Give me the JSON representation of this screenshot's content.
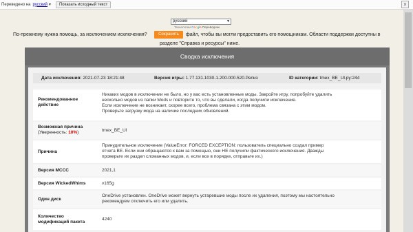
{
  "translate_bar": {
    "translated_to_label": "Переведено на",
    "language": "русский",
    "show_original_button": "Показать исходный текст",
    "close_glyph": "×"
  },
  "language_select": {
    "value": "русский",
    "powered_by": "Технологии",
    "google_letters": [
      "G",
      "o",
      "o",
      "g",
      "l",
      "e"
    ],
    "translator": "Переводчик"
  },
  "intro": {
    "line1_prefix": "По-прежнему нужна помощь, за исключением исключения?",
    "save_button": "Сохранить",
    "line1_suffix": "файл, чтобы вы могли предоставить его помощникам. Области поддержки доступны в",
    "line2": "разделе \"Справка и ресурсы\" ниже."
  },
  "panel": {
    "title": "Сводка исключения",
    "summary": {
      "date_label": "Дата исключения:",
      "date_value": "2021-07-23 18:21:48",
      "version_label": "Версия игры:",
      "version_value": "1.77.131.1030-1.200.000.520.Релиз",
      "category_label": "ID категории:",
      "category_value": "tmex_BE_UI.py:244"
    },
    "rows": {
      "recommended": {
        "label_line1": "Рекомендованное",
        "label_line2": "действие",
        "line1": "Никаких модов в исключении не было, но у вас есть установленные моды. Закройте игру, попробуйте удалить",
        "line2": "несколько модов из папки Mods и повторите то, что вы сделали, когда получили исключение.",
        "line3": "Если исключение не возникает, скорее всего, проблема связана с этим модом.",
        "line4": "Проверьте загрузку мода на наличие последних обновлений."
      },
      "cause": {
        "label": "Возможная причина",
        "confidence_prefix": "(Уверенность: ",
        "confidence_value": "10%",
        "confidence_suffix": ")",
        "value": "tmex_BE_UI"
      },
      "reason": {
        "label": "Причина",
        "line1": "Принудительное исключение (ValueError: FORCED EXCEPTION: пользователь специально создал пример",
        "line2": "отчета BE. Если они обращаются к вам за помощью, они НЕ получили фактического исключения. Дважды",
        "line3": "проверьте их раздел сломанных модов, и, если все в порядке, отправьте их.)"
      },
      "mccc": {
        "label": "Версия МССС",
        "value": "2021,1"
      },
      "wickedwhims": {
        "label": "Версия WickedWhims",
        "value": "v165g"
      },
      "onedrive": {
        "label": "Один диск",
        "line1": "OneDrive установлен. OneDrive может вернуть устаревшие моды после их удаления, поэтому мы настоятельно",
        "line2": "рекомендуем отключить его или удалить."
      },
      "package_count": {
        "label_line1": "Количество",
        "label_line2": "модификаций пакета",
        "value": "4240"
      }
    }
  },
  "colors": {
    "page_bg": "#f2efe6",
    "panel_bg": "#7a7a7a",
    "save_button": "#f78a1c",
    "confidence": "#d40000"
  }
}
